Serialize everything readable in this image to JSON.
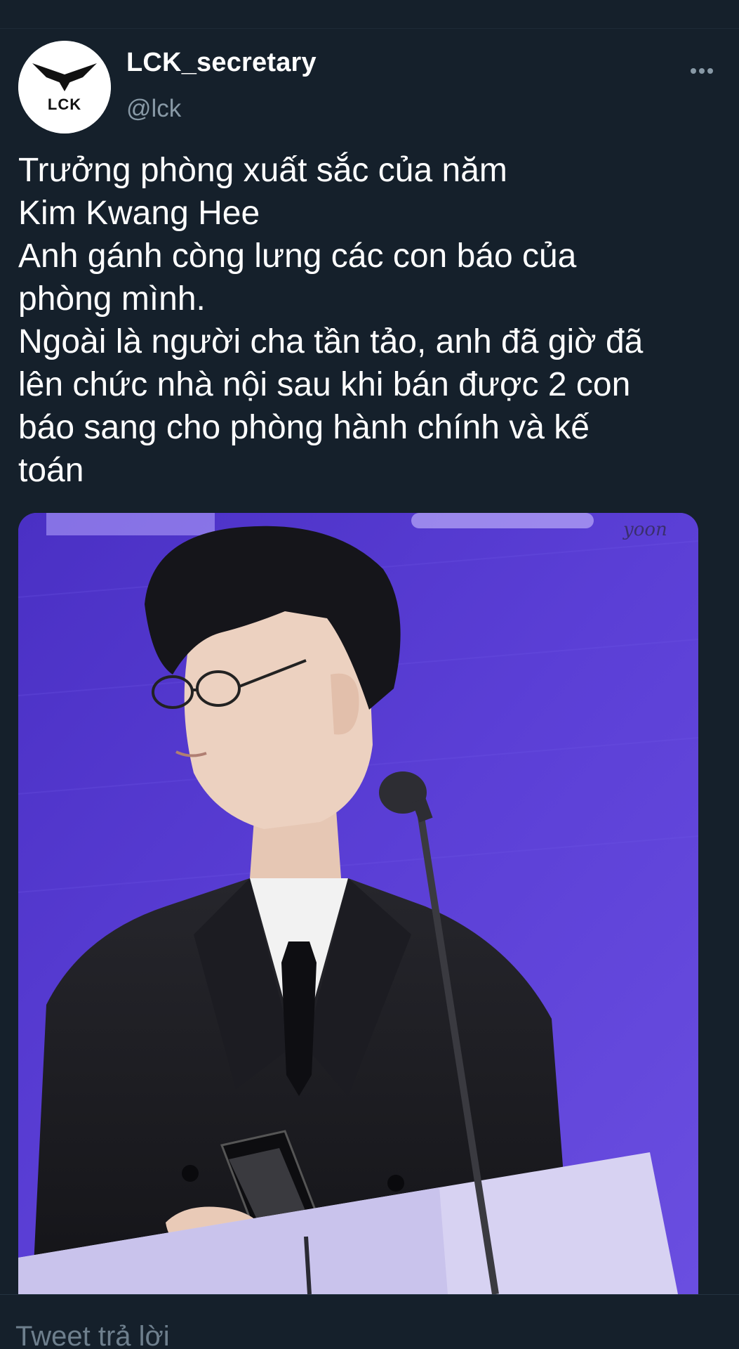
{
  "tweet": {
    "author": {
      "display_name": "LCK_secretary",
      "handle": "@lck",
      "avatar_logo_text": "LCK"
    },
    "text_lines": [
      "Trưởng phòng xuất sắc của năm",
      "Kim Kwang Hee",
      "Anh gánh còng lưng các con báo của",
      "phòng mình.",
      "Ngoài là người cha tần tảo, anh đã giờ đã",
      "lên chức nhà nội sau khi bán được 2 con",
      "báo sang cho phòng hành chính và kế",
      "toán"
    ],
    "media": {
      "watermark": "yoon",
      "icon": "photo-man-at-podium-microphone"
    }
  },
  "reply": {
    "placeholder": "Tweet trả lời"
  },
  "icons": {
    "more": "more-horizontal-icon"
  },
  "colors": {
    "background": "#15202b",
    "secondary_text": "#8899a6",
    "photo_stage": "#5b3ccf"
  }
}
